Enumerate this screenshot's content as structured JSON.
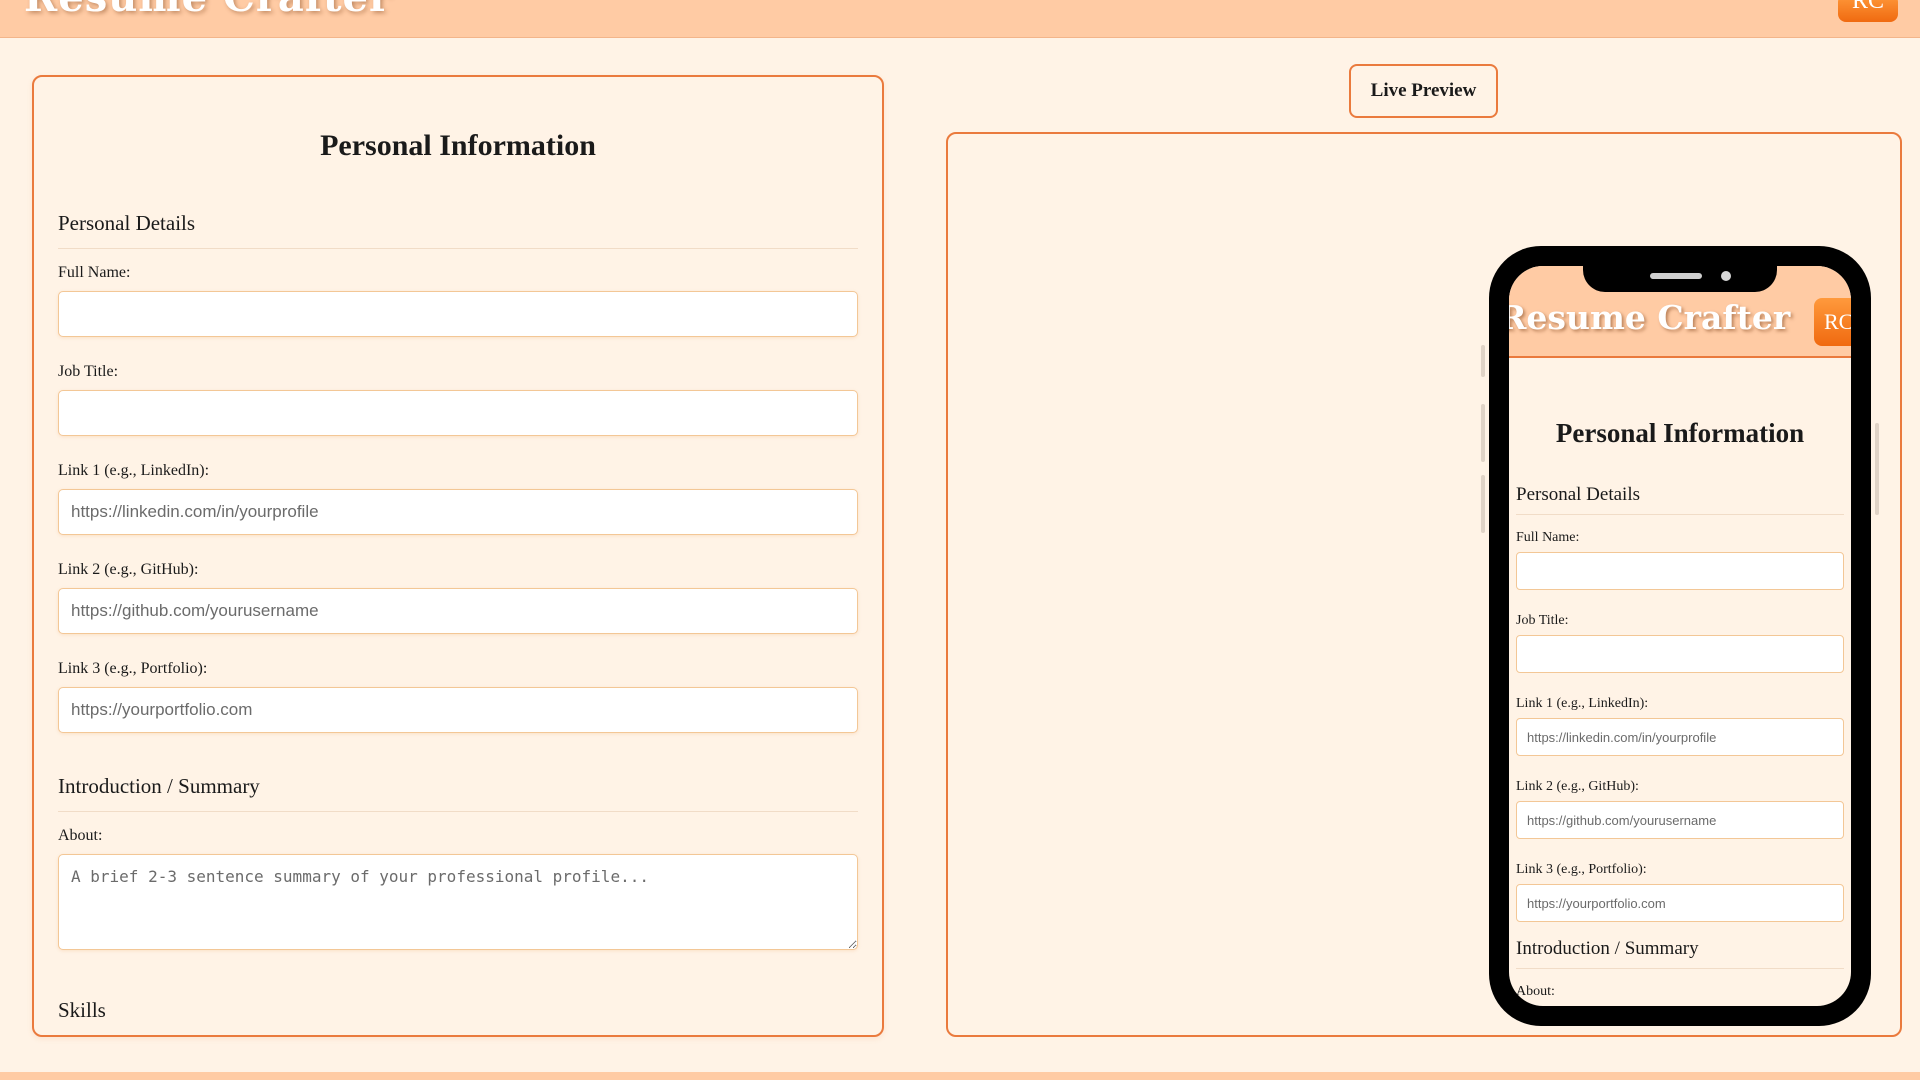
{
  "header": {
    "brand": "Resume Crafter",
    "avatar_initials": "RC"
  },
  "form": {
    "title": "Personal Information",
    "personal_details": {
      "heading": "Personal Details",
      "full_name_label": "Full Name:",
      "full_name_value": "",
      "job_title_label": "Job Title:",
      "job_title_value": "",
      "link1_label": "Link 1 (e.g., LinkedIn):",
      "link1_placeholder": "https://linkedin.com/in/yourprofile",
      "link2_label": "Link 2 (e.g., GitHub):",
      "link2_placeholder": "https://github.com/yourusername",
      "link3_label": "Link 3 (e.g., Portfolio):",
      "link3_placeholder": "https://yourportfolio.com"
    },
    "summary": {
      "heading": "Introduction / Summary",
      "about_label": "About:",
      "about_placeholder": "A brief 2-3 sentence summary of your professional profile..."
    },
    "skills": {
      "heading": "Skills"
    }
  },
  "preview": {
    "button_label": "Live Preview",
    "phone": {
      "brand": "Resume Crafter",
      "avatar_initials": "RC",
      "title": "Personal Information",
      "personal_details_heading": "Personal Details",
      "full_name_label": "Full Name:",
      "job_title_label": "Job Title:",
      "link1_label": "Link 1 (e.g., LinkedIn):",
      "link1_placeholder": "https://linkedin.com/in/yourprofile",
      "link2_label": "Link 2 (e.g., GitHub):",
      "link2_placeholder": "https://github.com/yourusername",
      "link3_label": "Link 3 (e.g., Portfolio):",
      "link3_placeholder": "https://yourportfolio.com",
      "summary_heading": "Introduction / Summary",
      "about_label": "About:"
    }
  },
  "colors": {
    "accent": "#ea7a3d",
    "header_bg": "#ffcba4",
    "page_bg": "#fff3e6",
    "avatar_gradient_top": "#ff9a3c",
    "avatar_gradient_bottom": "#f06a10"
  }
}
